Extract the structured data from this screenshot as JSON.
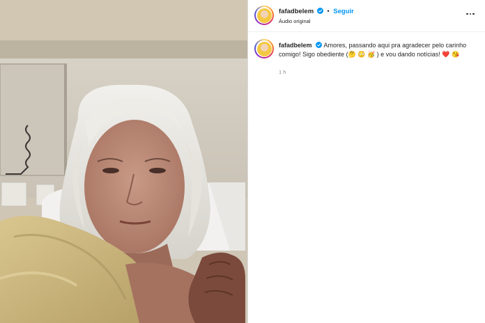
{
  "post": {
    "header": {
      "username": "fafadbelem",
      "separator": "•",
      "follow_label": "Seguir",
      "audio_label": "Áudio original"
    },
    "caption": {
      "username": "fafadbelem",
      "text": "Amores, passando aqui pra agradecer pelo carinho comigo! Sigo obediente (🤔 😳 🥳 ) e vou dando notícias! ❤️ 😘",
      "time": "1 h"
    }
  },
  "icons": {
    "verified": "verified-badge-icon",
    "more": "more-options-icon"
  },
  "colors": {
    "link": "#0095f6",
    "verified": "#0095f6",
    "text": "#262626",
    "muted": "#8e8e8e"
  }
}
